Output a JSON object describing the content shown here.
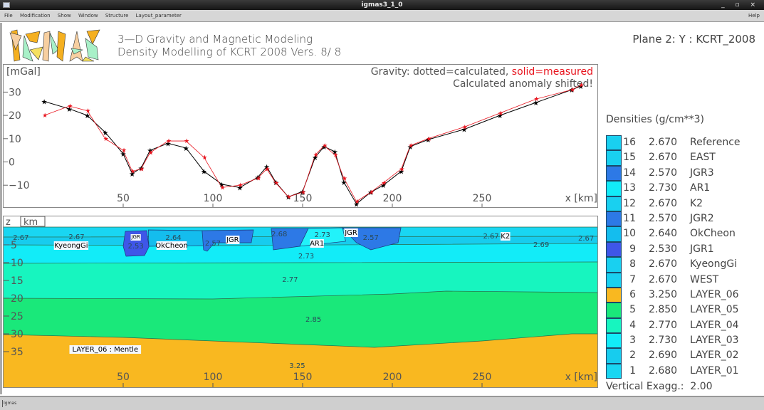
{
  "window": {
    "title": "igmas3_1_0",
    "controls": "_ ▫ ×"
  },
  "menu": {
    "items": [
      "File",
      "Modification",
      "Show",
      "Window",
      "Structure",
      "Layout_parameter"
    ],
    "help": "Help"
  },
  "logo": {
    "text": "IGMAS",
    "colors": [
      "#f5b020",
      "#f7cfa0",
      "#a8f0c8",
      "#f5e060",
      "#f5b020"
    ]
  },
  "header": {
    "line1": "3—D Gravity and Magnetic Modeling",
    "line2": "Density Modelling of KCRT 2008  Vers.   8/  8",
    "plane": "Plane  2: Y : KCRT_2008"
  },
  "gravity": {
    "ylabel": "[mGal]",
    "legend_prefix": "Gravity: dotted=calculated, ",
    "legend_measured": "solid=measured",
    "note": "Calculated anomaly shifted!",
    "xlabel": "x [km]",
    "yticks": [
      30,
      20,
      10,
      0,
      -10
    ],
    "xticks": [
      50,
      100,
      150,
      200,
      250
    ],
    "colors": {
      "calculated": "#000000",
      "measured": "#e8141e"
    },
    "x": [
      6,
      20,
      30,
      40,
      50,
      55,
      60,
      65,
      75,
      85,
      95,
      105,
      115,
      125,
      130,
      135,
      142,
      150,
      157,
      162,
      168,
      173,
      180,
      188,
      195,
      205,
      210,
      220,
      240,
      260,
      280,
      300,
      305
    ],
    "calculated": [
      26,
      22.8,
      20,
      12.7,
      3.5,
      -5,
      -2.6,
      5,
      8,
      6,
      -4,
      -9.6,
      -11,
      -6.6,
      -2,
      -8.7,
      -15,
      -12.7,
      2,
      6.6,
      4.4,
      -8.7,
      -18,
      -13,
      -10,
      -4,
      6.6,
      9.6,
      14,
      20,
      25.5,
      31,
      32.6
    ],
    "measured": [
      20,
      24,
      22,
      10,
      5,
      -4,
      -3,
      4,
      9,
      9,
      2,
      -11,
      -10,
      -7,
      -3,
      -9,
      -15,
      -13,
      3,
      7,
      3,
      -7,
      -17,
      -13,
      -9,
      -3,
      7,
      10,
      15,
      21,
      27,
      31,
      33
    ]
  },
  "model": {
    "zlabel": "z",
    "zunit": "km",
    "xlabel": "x [km]",
    "zticks": [
      -5,
      -10,
      -15,
      -20,
      -25,
      -30,
      -35
    ],
    "xticks": [
      50,
      100,
      150,
      200,
      250
    ],
    "layers": [
      {
        "name": "LAYER_01",
        "color": "#19d6f2",
        "top": [
          [
            -17,
            0
          ],
          [
            315,
            0
          ]
        ]
      },
      {
        "name": "LAYER_02",
        "color": "#17ccee",
        "top": [
          [
            -17,
            -2.8
          ],
          [
            315,
            -2.6
          ]
        ]
      },
      {
        "name": "LAYER_03",
        "color": "#12ecf8",
        "top": [
          [
            -17,
            -5
          ],
          [
            100,
            -5.2
          ],
          [
            315,
            -4.6
          ]
        ]
      },
      {
        "name": "LAYER_04",
        "color": "#17f5bf",
        "top": [
          [
            -17,
            -10.2
          ],
          [
            150,
            -10
          ],
          [
            315,
            -9.8
          ]
        ]
      },
      {
        "name": "LAYER_05",
        "color": "#1ae87a",
        "top": [
          [
            -17,
            -20
          ],
          [
            100,
            -20.2
          ],
          [
            200,
            -18.8
          ],
          [
            230,
            -18
          ],
          [
            315,
            -18.4
          ]
        ]
      },
      {
        "name": "LAYER_06",
        "color": "#f9b820",
        "top": [
          [
            -17,
            -30.2
          ],
          [
            50,
            -31
          ],
          [
            150,
            -33
          ],
          [
            190,
            -33.8
          ],
          [
            250,
            -32
          ],
          [
            300,
            -30
          ],
          [
            315,
            -30
          ]
        ]
      }
    ],
    "bodies": [
      {
        "name": "OkCheon",
        "color": "#14bdee",
        "poly": [
          [
            64,
            -0.8
          ],
          [
            94,
            -1
          ],
          [
            94.8,
            -5.2
          ],
          [
            64.3,
            -5.4
          ]
        ]
      },
      {
        "name": "JGR1",
        "color": "#3f56e8",
        "poly": [
          [
            51.2,
            -1.2
          ],
          [
            63.1,
            -1
          ],
          [
            64.3,
            -5.6
          ],
          [
            61.9,
            -8
          ],
          [
            51.6,
            -8.2
          ],
          [
            50,
            -5.4
          ]
        ]
      },
      {
        "name": "JGR2",
        "color": "#2d79e6",
        "poly": [
          [
            94,
            -1
          ],
          [
            122.6,
            -0.8
          ],
          [
            121.4,
            -4.4
          ],
          [
            100.8,
            -4.4
          ],
          [
            96.8,
            -6.8
          ],
          [
            94.8,
            -6.4
          ]
        ]
      },
      {
        "name": "2.68",
        "color": "#2d79e6",
        "poly": [
          [
            132.5,
            -0.4
          ],
          [
            153.2,
            -0.4
          ],
          [
            148.4,
            -5.4
          ],
          [
            133.7,
            -6.4
          ]
        ]
      },
      {
        "name": "AR1",
        "color": "#22f2fa",
        "poly": [
          [
            153.2,
            -0.4
          ],
          [
            172.2,
            -0.2
          ],
          [
            174,
            -4
          ],
          [
            148.4,
            -5.4
          ]
        ]
      },
      {
        "name": "JGR3",
        "color": "#2d79e6",
        "poly": [
          [
            172.2,
            -0.2
          ],
          [
            204.8,
            -0.2
          ],
          [
            203.2,
            -4.4
          ],
          [
            188,
            -6.4
          ],
          [
            180,
            -4.4
          ]
        ]
      }
    ],
    "labels": [
      {
        "t": "2.67",
        "x": -7,
        "z": -2.8
      },
      {
        "t": "2.67",
        "x": 24,
        "z": -2.6
      },
      {
        "t": "KyeongGi",
        "x": 21,
        "z": -5,
        "box": true
      },
      {
        "t": "JGR",
        "x": 57,
        "z": -2.4,
        "box": true,
        "small": true
      },
      {
        "t": "2.53",
        "x": 57,
        "z": -5.2
      },
      {
        "t": "2.64",
        "x": 78,
        "z": -2.8
      },
      {
        "t": "OkCheon",
        "x": 77,
        "z": -5,
        "box": true
      },
      {
        "t": "2.57",
        "x": 100,
        "z": -4.4
      },
      {
        "t": "JGR",
        "x": 111,
        "z": -3.4,
        "box": true
      },
      {
        "t": "2.68",
        "x": 137,
        "z": -1.8
      },
      {
        "t": "2.73",
        "x": 161,
        "z": -2
      },
      {
        "t": "AR1",
        "x": 158,
        "z": -4.4,
        "box": true
      },
      {
        "t": "JGR",
        "x": 177,
        "z": -1.4,
        "box": true
      },
      {
        "t": "2.57",
        "x": 188,
        "z": -2.8
      },
      {
        "t": "2.73",
        "x": 152,
        "z": -8
      },
      {
        "t": "2.67",
        "x": 255,
        "z": -2.4
      },
      {
        "t": "K2",
        "x": 263,
        "z": -2.4,
        "box": true
      },
      {
        "t": "2.69",
        "x": 283,
        "z": -4.8
      },
      {
        "t": "2.67",
        "x": 308,
        "z": -3
      },
      {
        "t": "2.77",
        "x": 143,
        "z": -14.6
      },
      {
        "t": "2.85",
        "x": 156,
        "z": -25.8
      },
      {
        "t": "LAYER_06 : Mentle",
        "x": 40,
        "z": -34.2,
        "box": true
      },
      {
        "t": "3.25",
        "x": 147,
        "z": -38.8
      }
    ]
  },
  "densities": {
    "title": "Densities (g/cm**3)",
    "rows": [
      {
        "n": "16",
        "d": "2.670",
        "name": "Reference",
        "color": "#19d0f0"
      },
      {
        "n": "15",
        "d": "2.670",
        "name": "EAST",
        "color": "#19d0f0"
      },
      {
        "n": "14",
        "d": "2.570",
        "name": "JGR3",
        "color": "#2d79e6"
      },
      {
        "n": "13",
        "d": "2.730",
        "name": "AR1",
        "color": "#12ecf8"
      },
      {
        "n": "12",
        "d": "2.670",
        "name": "K2",
        "color": "#19d0f0"
      },
      {
        "n": "11",
        "d": "2.570",
        "name": "JGR2",
        "color": "#2d79e6"
      },
      {
        "n": "10",
        "d": "2.640",
        "name": "OkCheon",
        "color": "#14bdee"
      },
      {
        "n": "9",
        "d": "2.530",
        "name": "JGR1",
        "color": "#3f56e8"
      },
      {
        "n": "8",
        "d": "2.670",
        "name": "KyeongGi",
        "color": "#19d0f0"
      },
      {
        "n": "7",
        "d": "2.670",
        "name": "WEST",
        "color": "#19d0f0"
      },
      {
        "n": "6",
        "d": "3.250",
        "name": "LAYER_06",
        "color": "#f9b820"
      },
      {
        "n": "5",
        "d": "2.850",
        "name": "LAYER_05",
        "color": "#1ae87a"
      },
      {
        "n": "4",
        "d": "2.770",
        "name": "LAYER_04",
        "color": "#17f5bf"
      },
      {
        "n": "3",
        "d": "2.730",
        "name": "LAYER_03",
        "color": "#12ecf8"
      },
      {
        "n": "2",
        "d": "2.690",
        "name": "LAYER_02",
        "color": "#17ccee"
      },
      {
        "n": "1",
        "d": "2.680",
        "name": "LAYER_01",
        "color": "#19d6f2"
      }
    ],
    "vexag_label": "Vertical Exagg.:",
    "vexag": "2.00"
  },
  "status": {
    "text": "Igmas"
  }
}
